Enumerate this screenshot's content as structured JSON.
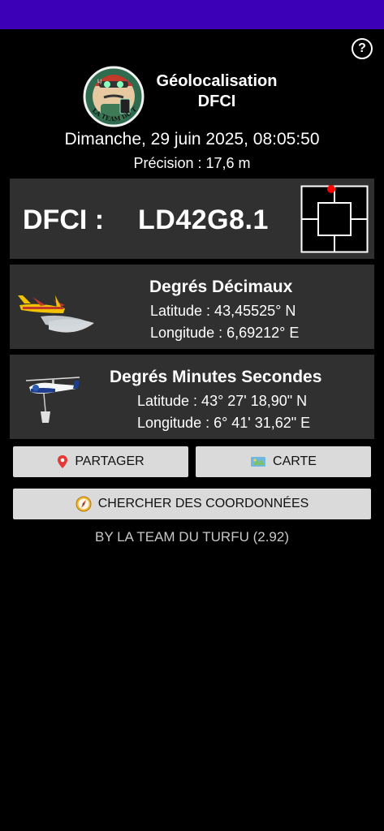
{
  "header": {
    "help_label": "?",
    "title_line1": "Géolocalisation",
    "title_line2": "DFCI",
    "logo_text": "LA TEAM DU TURFU",
    "logo_badge": "LJ"
  },
  "datetime": "Dimanche, 29 juin 2025, 08:05:50",
  "precision": "Précision : 17,6 m",
  "dfci": {
    "label": "DFCI :",
    "code": "LD42G8.1",
    "grid_marker_color": "#ff0000"
  },
  "decimal": {
    "title": "Degrés Décimaux",
    "latitude": "Latitude : 43,45525° N",
    "longitude": "Longitude : 6,69212° E",
    "icon": "canadair-plane-icon"
  },
  "dms": {
    "title": "Degrés Minutes Secondes",
    "latitude": "Latitude : 43° 27' 18,90\" N",
    "longitude": "Longitude : 6° 41' 31,62\" E",
    "icon": "helicopter-icon"
  },
  "buttons": {
    "share": "PARTAGER",
    "map": "CARTE",
    "search": "CHERCHER DES COORDONNÉES"
  },
  "footer": "BY LA TEAM DU TURFU (2.92)",
  "colors": {
    "status_bar": "#3c00b6",
    "panel_bg": "#303030",
    "button_bg": "#dadada"
  }
}
